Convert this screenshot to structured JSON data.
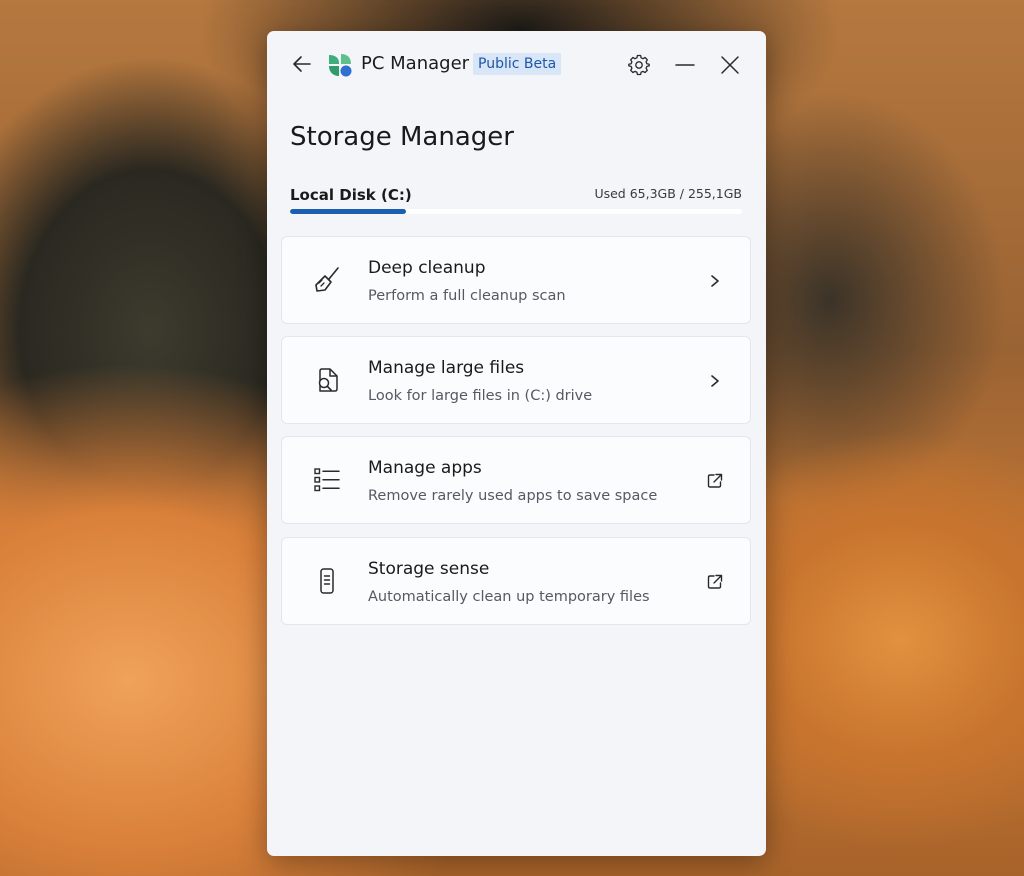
{
  "window": {
    "app_title": "PC Manager",
    "badge": "Public Beta",
    "icons": {
      "back": "back-arrow-icon",
      "logo": "pc-manager-logo-icon",
      "settings": "gear-icon",
      "minimize": "minimize-icon",
      "close": "close-icon"
    }
  },
  "page": {
    "title": "Storage Manager"
  },
  "disk": {
    "label": "Local Disk (C:)",
    "usage_text": "Used 65,3GB / 255,1GB",
    "used_gb": 65.3,
    "total_gb": 255.1,
    "bar_color": "#1b5fb3"
  },
  "items": [
    {
      "title": "Deep cleanup",
      "subtitle": "Perform a full cleanup scan",
      "icon": "broom-icon",
      "action_icon": "chevron-right-icon"
    },
    {
      "title": "Manage large files",
      "subtitle": "Look for large files in (C:) drive",
      "icon": "file-search-icon",
      "action_icon": "chevron-right-icon"
    },
    {
      "title": "Manage apps",
      "subtitle": "Remove rarely used apps to save space",
      "icon": "app-list-icon",
      "action_icon": "open-external-icon"
    },
    {
      "title": "Storage sense",
      "subtitle": "Automatically clean up temporary files",
      "icon": "storage-device-icon",
      "action_icon": "open-external-icon"
    }
  ]
}
